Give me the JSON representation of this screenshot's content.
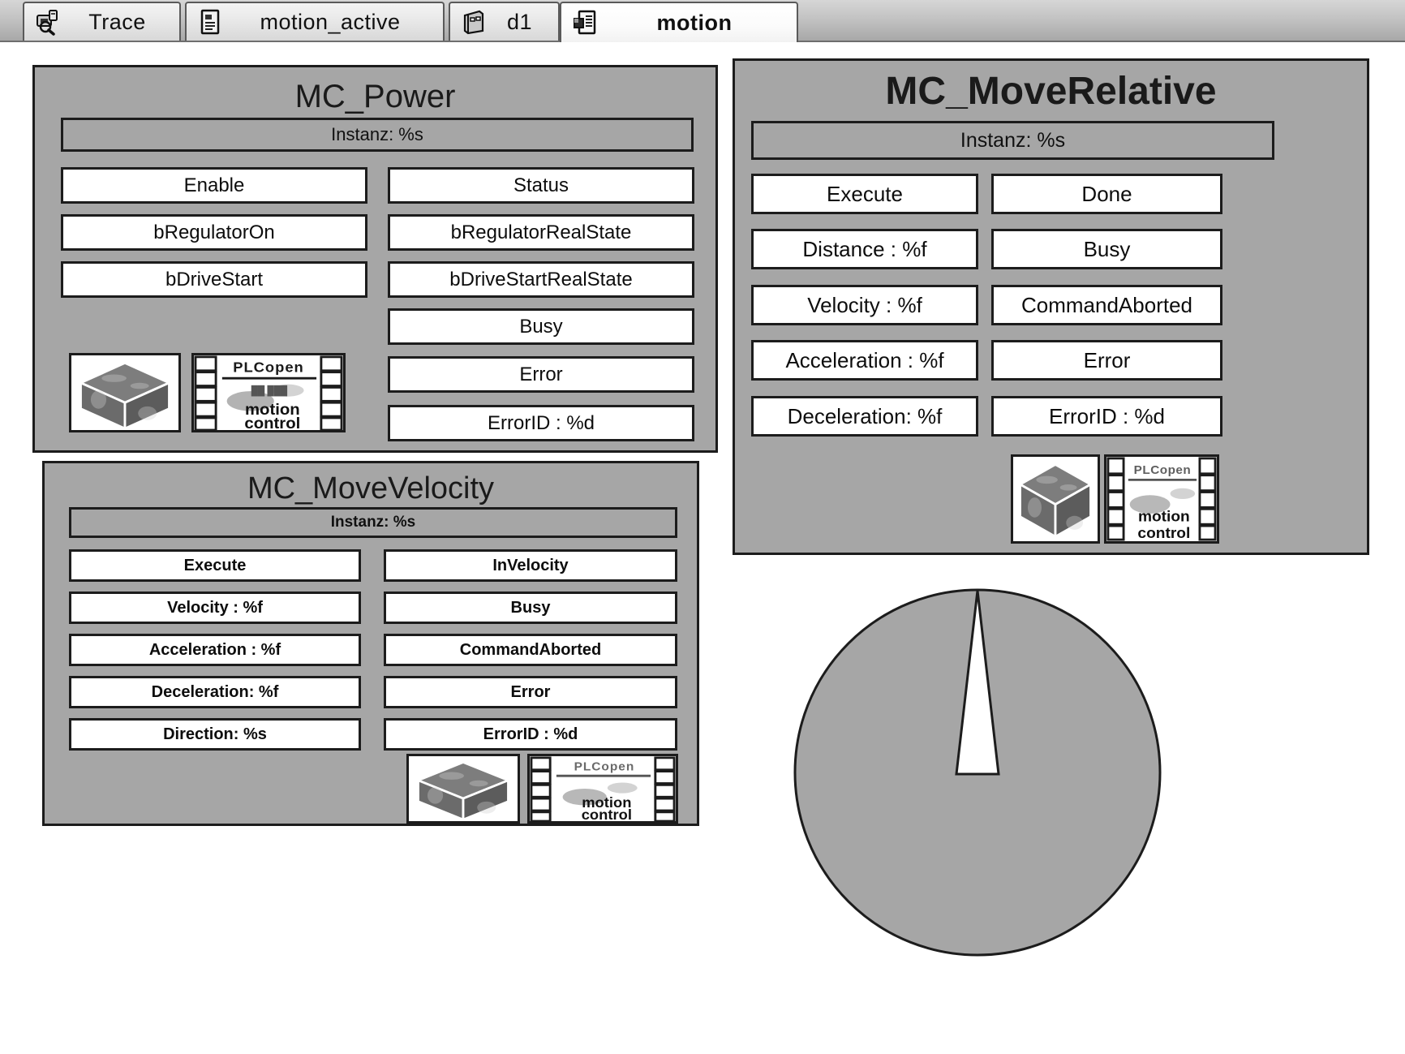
{
  "window": {
    "title": "motion",
    "background_color": "#ffffff",
    "panel_color": "#a6a6a6",
    "field_color": "#ffffff",
    "border_color": "#1c1c1c"
  },
  "tabs": [
    {
      "label": "Trace",
      "icon": "trace-magnifier-icon",
      "active": false
    },
    {
      "label": "motion_active",
      "icon": "document-icon",
      "active": false
    },
    {
      "label": "d1",
      "icon": "device-icon",
      "active": false
    },
    {
      "label": "motion",
      "icon": "visualization-icon",
      "active": true
    }
  ],
  "panels": [
    {
      "id": "mc-power",
      "title": "MC_Power",
      "instance_label": "Instanz: %s",
      "inputs": [
        "Enable",
        "bRegulatorOn",
        "bDriveStart"
      ],
      "outputs": [
        "Status",
        "bRegulatorRealState",
        "bDriveStartRealState",
        "Busy",
        "Error",
        "ErrorID : %d"
      ],
      "logos": [
        "cube-logo",
        "plcopen-motion-control-logo"
      ]
    },
    {
      "id": "mc-movevelocity",
      "title": "MC_MoveVelocity",
      "instance_label": "Instanz: %s",
      "inputs": [
        "Execute",
        "Velocity : %f",
        "Acceleration : %f",
        "Deceleration: %f",
        "Direction: %s"
      ],
      "outputs": [
        "InVelocity",
        "Busy",
        "CommandAborted",
        "Error",
        "ErrorID : %d"
      ],
      "logos": [
        "cube-logo",
        "plcopen-motion-control-logo"
      ]
    },
    {
      "id": "mc-moverelative",
      "title": "MC_MoveRelative",
      "instance_label": "Instanz: %s",
      "inputs": [
        "Execute",
        "Distance : %f",
        "Velocity : %f",
        "Acceleration : %f",
        "Deceleration: %f"
      ],
      "outputs": [
        "Done",
        "Busy",
        "CommandAborted",
        "Error",
        "ErrorID : %d"
      ],
      "logos": [
        "cube-logo",
        "plcopen-motion-control-logo"
      ]
    }
  ],
  "logo": {
    "brand_top": "PLCopen",
    "brand_line1": "motion",
    "brand_line2": "control"
  },
  "gauge": {
    "name": "rotary-position-gauge",
    "needle_angle_deg": 0,
    "dial_color": "#a6a6a6",
    "needle_color": "#ffffff"
  }
}
